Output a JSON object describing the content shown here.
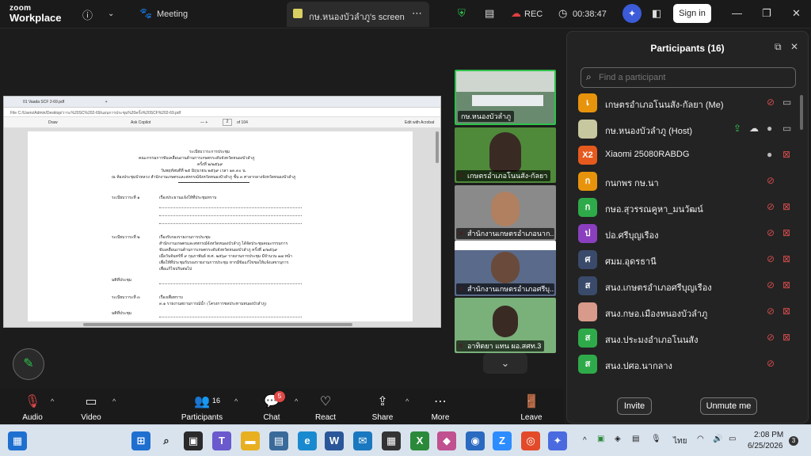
{
  "app": {
    "logo_top": "zoom",
    "logo_bottom": "Workplace",
    "meeting_label": "Meeting",
    "screen_tab": "กษ.หนองบัวลำภู's screen",
    "rec_label": "REC",
    "timer": "00:38:47",
    "sign_in": "Sign in"
  },
  "browser": {
    "tab_title": "01 Vaada SCF 2-69.pdf",
    "address": "File C:/Users/Admin/Desktop/วาระ%20SC%202-69/แผนการประชุม%20ครั้ง%20SCF%202-69.pdf",
    "draw": "Draw",
    "copilot": "Ask Copilot",
    "page_number": "2",
    "page_total": "of 104",
    "edit_acrobat": "Edit with Acrobat"
  },
  "doc": {
    "h1": "ระเบียบวาระการประชุม",
    "h2": "คณะกรรมการขับเคลื่อนงานด้านการเกษตรระดับจังหวัดหนองบัวลำภู",
    "h3": "ครั้งที่ ๒/๒๕๖๙",
    "h4": "วันพฤหัสบดีที่ ๒๕ มิถุนายน ๒๕๖๙ เวลา ๑๓.๓๐ น.",
    "h5": "ณ ห้องประชุมบัวหลวง สำนักงานเกษตรและสหกรณ์จังหวัดหนองบัวลำภู ชั้น ๓ ศาลากลางจังหวัดหนองบัวลำภู",
    "agenda1_label": "ระเบียบวาระที่ ๑",
    "agenda1_title": "เรื่องประธานแจ้งให้ที่ประชุมทราบ",
    "agenda2_label": "ระเบียบวาระที่ ๒",
    "agenda2_title": "เรื่องรับรองรายงานการประชุม",
    "agenda2_body": [
      "สำนักงานเกษตรและสหกรณ์จังหวัดหนองบัวลำภู ได้จัดประชุมคณะกรรมการ",
      "ขับเคลื่อนงานด้านการเกษตรระดับจังหวัดหนองบัวลำภู ครั้งที่ ๑/๒๕๖๙",
      "เมื่อวันจันทร์ที่ ๙ กุมภาพันธ์ พ.ศ. ๒๕๖๙ รายงานการประชุม มีจำนวน ๑๗ หน้า",
      "เพื่อให้ที่ประชุมรับรองรายงานการประชุม หากมีข้อแก้ไขขอให้แจ้งเลขานุการ",
      "เพื่อแก้ไขปรับต่อไป"
    ],
    "resolution1": "มติที่ประชุม",
    "agenda3_label": "ระเบียบวาระที่ ๓",
    "agenda3_title": "เรื่องเพื่อทราบ",
    "agenda3_sub": "๓.๑ รายงานสถานการณ์น้ำ (โครงการชลประทานหนองบัวลำภู)",
    "resolution2": "มติที่ประชุม"
  },
  "gallery": [
    {
      "name": "กษ.หนองบัวลำภู",
      "muted": false
    },
    {
      "name": "เกษตรอำเภอโนนสัง-กัลยา",
      "muted": true
    },
    {
      "name": "สำนักงานเกษตรอำเภอนาก...",
      "muted": true
    },
    {
      "name": "สำนักงานเกษตรอำเภอศรีบุ...",
      "muted": true
    },
    {
      "name": "อาทิตยา แทน ผอ.สศท.3",
      "muted": true
    }
  ],
  "participants": {
    "title": "Participants (16)",
    "search_placeholder": "Find a participant",
    "items": [
      {
        "initial": "เ",
        "name": "เกษตรอำเภอโนนสัง-กัลยา (Me)",
        "color": "#e8930c",
        "mic": "muted",
        "video": "on"
      },
      {
        "initial": "",
        "name": "กษ.หนองบัวลำภู (Host)",
        "color": "#c8c8a0",
        "mic": "on",
        "video": "on"
      },
      {
        "initial": "X2",
        "name": "Xiaomi 25080RABDG",
        "color": "#e65a1e",
        "mic": "on",
        "video": "off"
      },
      {
        "initial": "ก",
        "name": "กนกพร กษ.นา",
        "color": "#e8930c",
        "mic": "muted",
        "video": "none"
      },
      {
        "initial": "ก",
        "name": "กษอ.สุวรรณคูหา_มนวัฒน์",
        "color": "#2faa4a",
        "mic": "muted",
        "video": "off"
      },
      {
        "initial": "ป",
        "name": "ปอ.ศรีบุญเรือง",
        "color": "#8a3fbf",
        "mic": "muted",
        "video": "off"
      },
      {
        "initial": "ศ",
        "name": "ศมม.อุดรธานี",
        "color": "#3a4a6a",
        "mic": "muted",
        "video": "off"
      },
      {
        "initial": "ส",
        "name": "สนง.เกษตรอำเภอศรีบุญเรือง",
        "color": "#3a4a6a",
        "mic": "muted",
        "video": "off"
      },
      {
        "initial": "",
        "name": "สนง.กษอ.เมืองหนองบัวลำภู",
        "color": "#d89a8a",
        "mic": "muted",
        "video": "off"
      },
      {
        "initial": "ส",
        "name": "สนง.ประมงอำเภอโนนสัง",
        "color": "#2faa4a",
        "mic": "muted",
        "video": "off"
      },
      {
        "initial": "ส",
        "name": "สนง.ปศอ.นากลาง",
        "color": "#2faa4a",
        "mic": "muted",
        "video": "none"
      }
    ],
    "invite": "Invite",
    "unmute": "Unmute me"
  },
  "controls": {
    "audio": "Audio",
    "video": "Video",
    "participants": "Participants",
    "participants_count": "16",
    "chat": "Chat",
    "chat_badge": "5",
    "react": "React",
    "share": "Share",
    "more": "More",
    "leave": "Leave"
  },
  "taskbar": {
    "time": "2:08 PM",
    "date": "6/25/2026",
    "lang": "ไทย",
    "badge": "3"
  }
}
